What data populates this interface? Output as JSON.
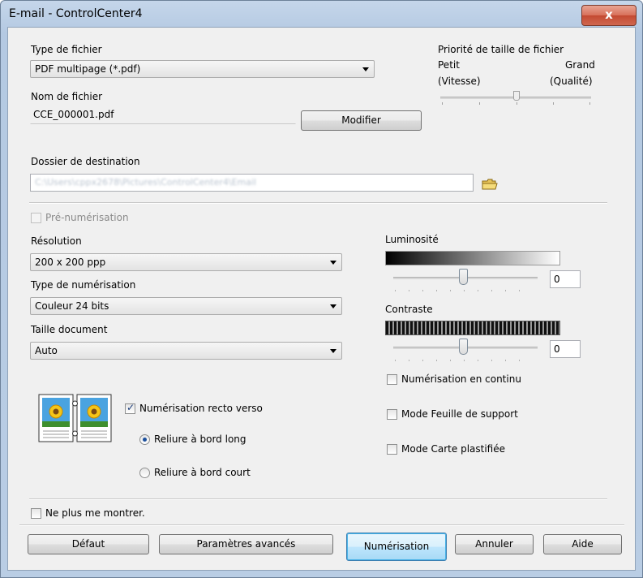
{
  "window": {
    "title": "E-mail - ControlCenter4",
    "close_glyph": "x"
  },
  "file_type": {
    "label": "Type de fichier",
    "value": "PDF multipage (*.pdf)"
  },
  "file_name": {
    "label": "Nom de fichier",
    "value": "CCE_000001.pdf",
    "modify_button": "Modifier"
  },
  "size_priority": {
    "label": "Priorité de taille de fichier",
    "small": "Petit",
    "large": "Grand",
    "speed": "(Vitesse)",
    "quality": "(Qualité)"
  },
  "destination": {
    "label": "Dossier de destination",
    "value": "C:\\Users\\cppx2678\\Pictures\\ControlCenter4\\Email",
    "folder_icon": "folder-icon"
  },
  "prescan": {
    "label": "Pré-numérisation",
    "checked": false,
    "enabled": false
  },
  "resolution": {
    "label": "Résolution",
    "value": "200 x 200 ppp"
  },
  "scan_type": {
    "label": "Type de numérisation",
    "value": "Couleur 24 bits"
  },
  "doc_size": {
    "label": "Taille document",
    "value": "Auto"
  },
  "brightness": {
    "label": "Luminosité",
    "value": "0"
  },
  "contrast": {
    "label": "Contraste",
    "value": "0"
  },
  "continuous": {
    "label": "Numérisation en continu",
    "checked": false
  },
  "carrier_sheet": {
    "label": "Mode Feuille de support",
    "checked": false
  },
  "plastic_card": {
    "label": "Mode Carte plastifiée",
    "checked": false
  },
  "duplex": {
    "label": "Numérisation recto verso",
    "checked": true,
    "long_edge": "Reliure à bord long",
    "short_edge": "Reliure à bord court",
    "selected": "long_edge"
  },
  "dont_show": {
    "label": "Ne plus me montrer.",
    "checked": false
  },
  "buttons": {
    "default": "Défaut",
    "advanced": "Paramètres avancés",
    "scan": "Numérisation",
    "cancel": "Annuler",
    "help": "Aide"
  },
  "colors": {
    "accent": "#3c7fb1",
    "titlebar": "#b9cde4",
    "close": "#c34a32"
  }
}
